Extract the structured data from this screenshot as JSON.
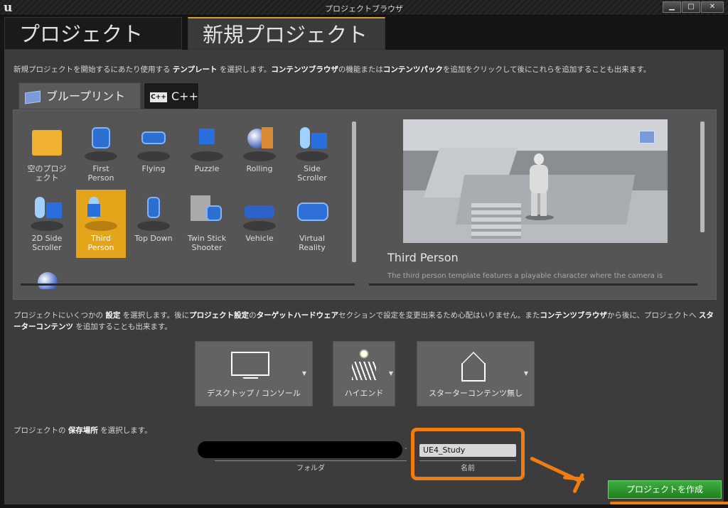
{
  "window": {
    "title": "プロジェクトブラウザ",
    "logo": "u",
    "buttons": {
      "minimize": "▁",
      "maximize": "□",
      "close": "✕"
    }
  },
  "main_tabs": [
    {
      "label": "プロジェクト"
    },
    {
      "label": "新規プロジェクト"
    }
  ],
  "intro": {
    "pre": "新規プロジェクトを開始するにあたり使用する ",
    "b1": "テンプレート",
    "mid1": " を選択します。",
    "b2": "コンテンツブラウザ",
    "mid2": "の機能または",
    "b3": "コンテンツパック",
    "post": "を追加をクリックして後にこれらを追加することも出来ます。"
  },
  "sub_tabs": [
    {
      "label": "ブループリント",
      "icon": "blueprint-icon"
    },
    {
      "label": "C++",
      "icon": "cpp-icon",
      "icon_text": "C++"
    }
  ],
  "templates": [
    {
      "name": "空のプロジェクト",
      "line1": "空のプロジ",
      "line2": "ェクト",
      "icon": "folder"
    },
    {
      "name": "First Person",
      "line1": "First",
      "line2": "Person",
      "icon": "blob"
    },
    {
      "name": "Flying",
      "line1": "Flying",
      "line2": "",
      "icon": "blob"
    },
    {
      "name": "Puzzle",
      "line1": "Puzzle",
      "line2": "",
      "icon": "cube"
    },
    {
      "name": "Rolling",
      "line1": "Rolling",
      "line2": "",
      "icon": "sphere"
    },
    {
      "name": "Side Scroller",
      "line1": "Side",
      "line2": "Scroller",
      "icon": "pill"
    },
    {
      "name": "2D Side Scroller",
      "line1": "2D Side",
      "line2": "Scroller",
      "icon": "pill"
    },
    {
      "name": "Third Person",
      "line1": "Third",
      "line2": "Person",
      "icon": "pill",
      "selected": true
    },
    {
      "name": "Top Down",
      "line1": "Top Down",
      "line2": "",
      "icon": "blob"
    },
    {
      "name": "Twin Stick Shooter",
      "line1": "Twin Stick",
      "line2": "Shooter",
      "icon": "shooter"
    },
    {
      "name": "Vehicle",
      "line1": "Vehicle",
      "line2": "",
      "icon": "car"
    },
    {
      "name": "Virtual Reality",
      "line1": "Virtual",
      "line2": "Reality",
      "icon": "vr"
    }
  ],
  "preview": {
    "title": "Third Person",
    "description": "The third person template features a playable character where the camera is"
  },
  "settings_hint": {
    "pre": "プロジェクトにいくつかの ",
    "b1": "設定",
    "mid1": " を選択します。後に",
    "b2": "プロジェクト設定",
    "mid2": "の",
    "b3": "ターゲットハードウェア",
    "mid3": "セクションで設定を変更出来るため心配はいりません。また",
    "b4": "コンテンツブラウザ",
    "mid4": "から後に、プロジェクトへ ",
    "b5": "スターターコンテンツ",
    "post": " を追加することも出来ます。"
  },
  "settings": [
    {
      "label": "デスクトップ / コンソール",
      "icon": "monitor-icon"
    },
    {
      "label": "ハイエンド",
      "icon": "high-quality-icon"
    },
    {
      "label": "スターターコンテンツ無し",
      "icon": "no-starter-content-icon"
    }
  ],
  "location": {
    "pre": "プロジェクトの ",
    "b1": "保存場所",
    "post": " を選択します。",
    "folder_value": "",
    "separator": "-",
    "name_value": "UE4_Study",
    "folder_caption": "フォルダ",
    "name_caption": "名前"
  },
  "create_button": "プロジェクトを作成",
  "colors": {
    "selected_tile": "#e4a51a",
    "create_button": "#2f9a2f",
    "annotation": "#f07d12"
  }
}
